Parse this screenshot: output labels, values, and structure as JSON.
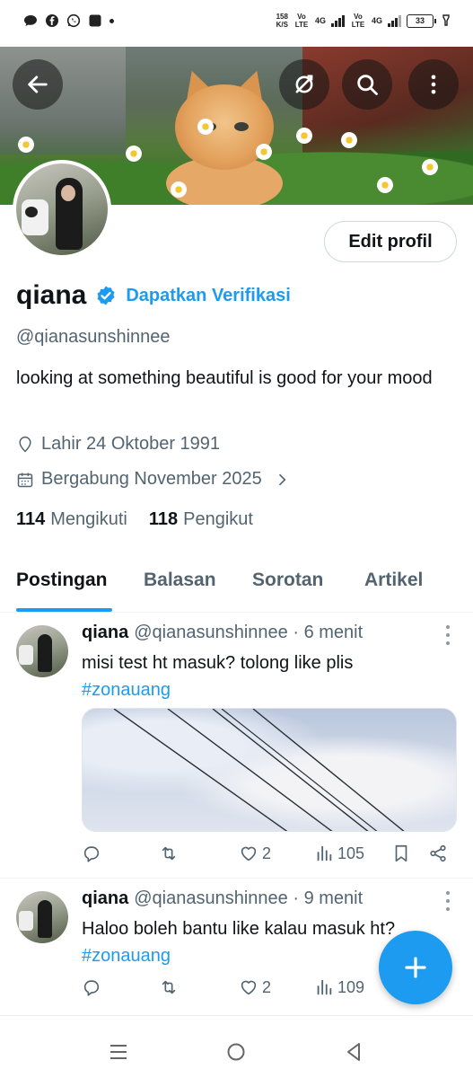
{
  "status_bar": {
    "speed_value": "158",
    "speed_unit": "K/S",
    "sim1": "Vo LTE",
    "net1": "4G",
    "sim2": "Vo LTE",
    "net2": "4G",
    "battery": "33"
  },
  "profile": {
    "name": "qiana",
    "verify_label": "Dapatkan Verifikasi",
    "handle": "@qianasunshinnee",
    "bio": "looking at something beautiful is good for your mood",
    "birth": "Lahir 24 Oktober 1991",
    "joined": "Bergabung November 2025",
    "following_count": "114",
    "following_label": "Mengikuti",
    "followers_count": "118",
    "followers_label": "Pengikut",
    "edit_label": "Edit profil"
  },
  "tabs": [
    {
      "label": "Postingan",
      "active": true
    },
    {
      "label": "Balasan",
      "active": false
    },
    {
      "label": "Sorotan",
      "active": false
    },
    {
      "label": "Artikel",
      "active": false
    }
  ],
  "tweets": [
    {
      "name": "qiana",
      "meta": "@qianasunshinnee · 6 menit",
      "text": "misi test ht masuk? tolong like plis",
      "hashtag": "#zonauang",
      "likes": "2",
      "views": "105"
    },
    {
      "name": "qiana",
      "meta": "@qianasunshinnee · 9 menit",
      "text": "Haloo boleh bantu like kalau masuk ht?",
      "hashtag": "#zonauang",
      "likes": "2",
      "views": "109"
    }
  ],
  "colors": {
    "accent": "#1d9bf0",
    "text": "#0f1419",
    "secondary": "#536471"
  },
  "icons": [
    "back-arrow-icon",
    "sync-off-icon",
    "search-icon",
    "more-vertical-icon",
    "verified-badge-icon",
    "location-icon",
    "calendar-icon",
    "chevron-right-icon",
    "reply-icon",
    "retweet-icon",
    "like-icon",
    "views-icon",
    "bookmark-icon",
    "share-icon",
    "compose-plus-icon",
    "menu-nav-icon",
    "home-nav-icon",
    "back-nav-icon"
  ]
}
